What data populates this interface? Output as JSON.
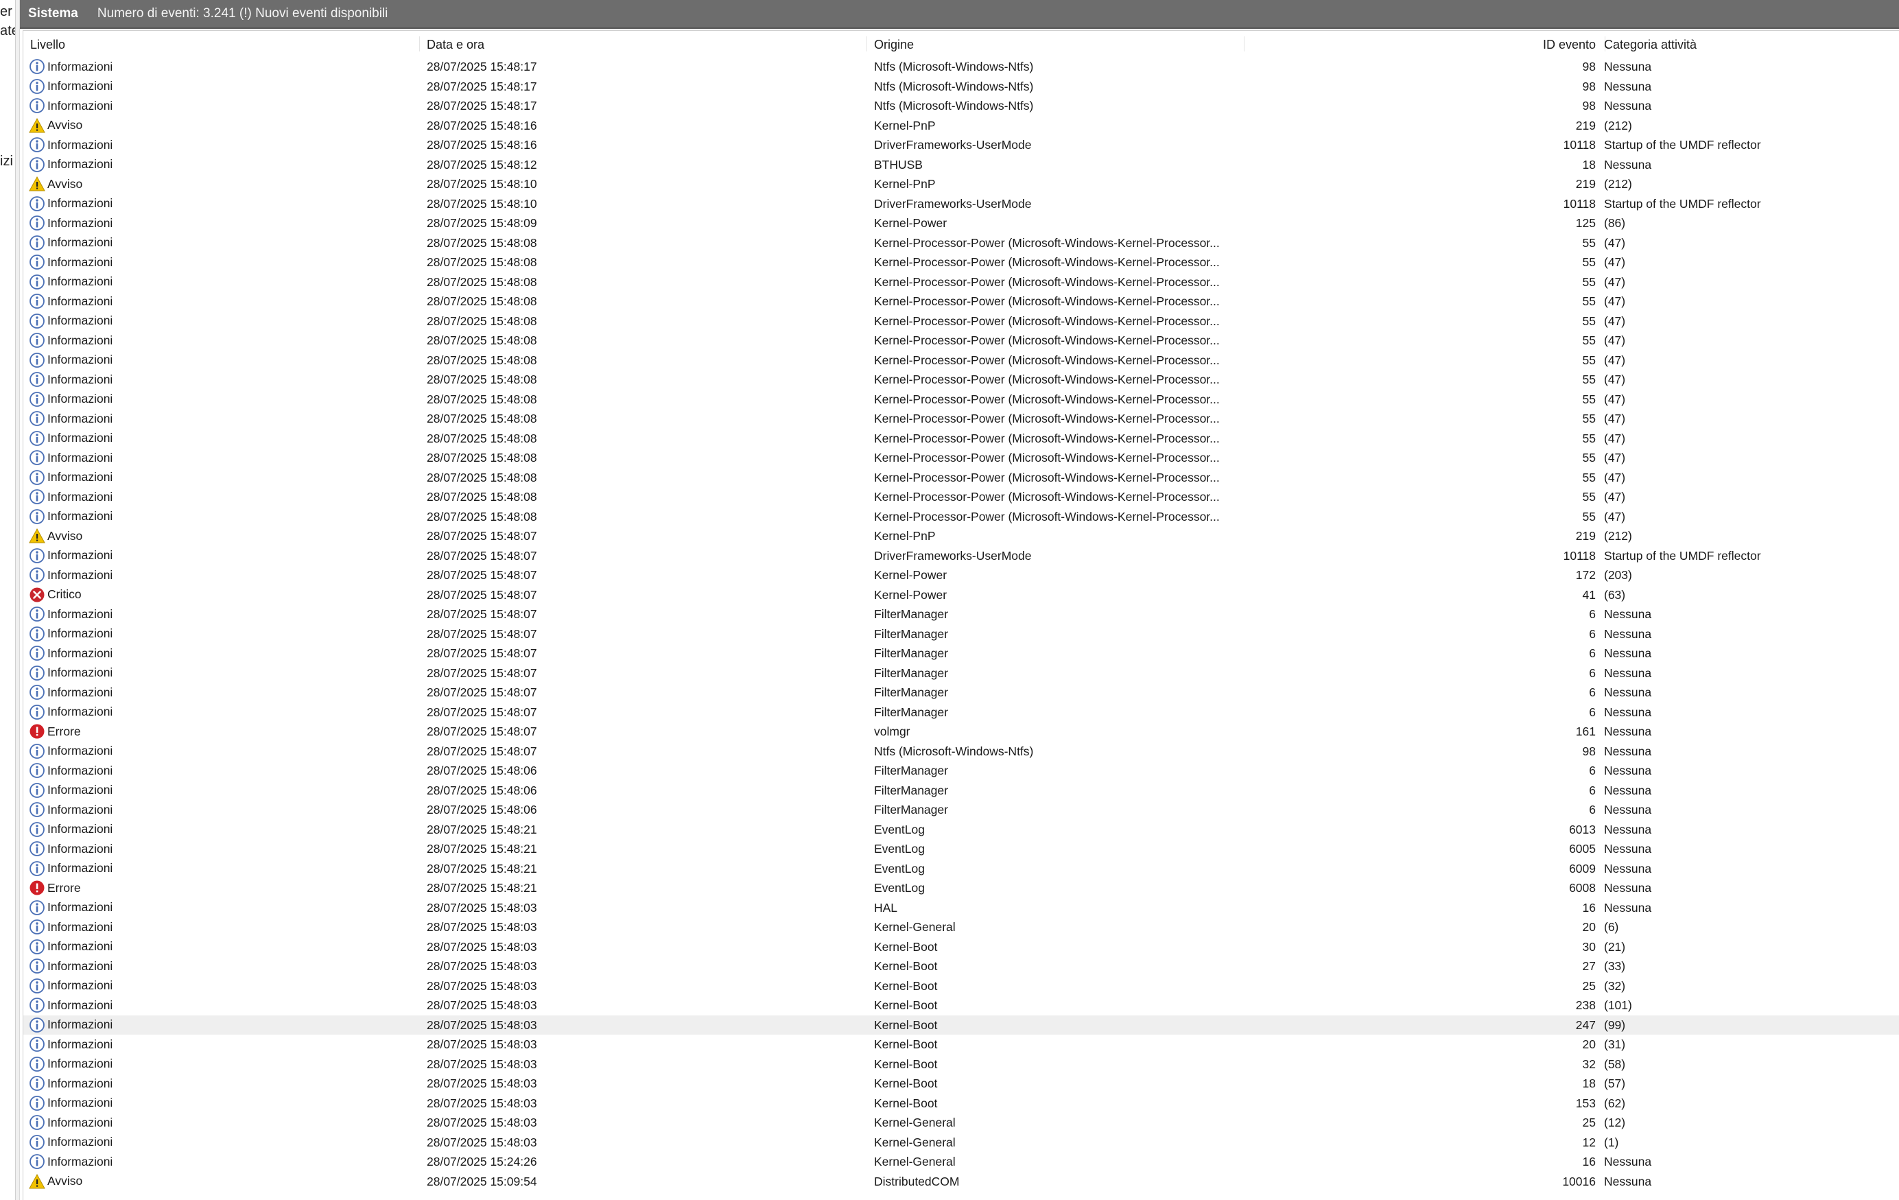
{
  "left_pane_fragments": [
    "er l",
    "ate",
    "izi"
  ],
  "titlebar": {
    "pane_name": "Sistema",
    "info": "Numero di eventi: 3.241 (!) Nuovi eventi disponibili"
  },
  "columns": {
    "level": "Livello",
    "date": "Data e ora",
    "source": "Origine",
    "id": "ID evento",
    "category": "Categoria attività"
  },
  "icon_colors": {
    "info": "#4a6fb5",
    "warning": "#f2c200",
    "error": "#d11f26",
    "critical": "#c8262d"
  },
  "selected_row_index": 49,
  "events": [
    {
      "level": "Informazioni",
      "icon": "info-icon",
      "date": "28/07/2025 15:48:17",
      "source": "Ntfs (Microsoft-Windows-Ntfs)",
      "id": "98",
      "category": "Nessuna"
    },
    {
      "level": "Informazioni",
      "icon": "info-icon",
      "date": "28/07/2025 15:48:17",
      "source": "Ntfs (Microsoft-Windows-Ntfs)",
      "id": "98",
      "category": "Nessuna"
    },
    {
      "level": "Informazioni",
      "icon": "info-icon",
      "date": "28/07/2025 15:48:17",
      "source": "Ntfs (Microsoft-Windows-Ntfs)",
      "id": "98",
      "category": "Nessuna"
    },
    {
      "level": "Avviso",
      "icon": "warning-icon",
      "date": "28/07/2025 15:48:16",
      "source": "Kernel-PnP",
      "id": "219",
      "category": "(212)"
    },
    {
      "level": "Informazioni",
      "icon": "info-icon",
      "date": "28/07/2025 15:48:16",
      "source": "DriverFrameworks-UserMode",
      "id": "10118",
      "category": "Startup of the UMDF reflector"
    },
    {
      "level": "Informazioni",
      "icon": "info-icon",
      "date": "28/07/2025 15:48:12",
      "source": "BTHUSB",
      "id": "18",
      "category": "Nessuna"
    },
    {
      "level": "Avviso",
      "icon": "warning-icon",
      "date": "28/07/2025 15:48:10",
      "source": "Kernel-PnP",
      "id": "219",
      "category": "(212)"
    },
    {
      "level": "Informazioni",
      "icon": "info-icon",
      "date": "28/07/2025 15:48:10",
      "source": "DriverFrameworks-UserMode",
      "id": "10118",
      "category": "Startup of the UMDF reflector"
    },
    {
      "level": "Informazioni",
      "icon": "info-icon",
      "date": "28/07/2025 15:48:09",
      "source": "Kernel-Power",
      "id": "125",
      "category": "(86)"
    },
    {
      "level": "Informazioni",
      "icon": "info-icon",
      "date": "28/07/2025 15:48:08",
      "source": "Kernel-Processor-Power (Microsoft-Windows-Kernel-Processor...",
      "id": "55",
      "category": "(47)"
    },
    {
      "level": "Informazioni",
      "icon": "info-icon",
      "date": "28/07/2025 15:48:08",
      "source": "Kernel-Processor-Power (Microsoft-Windows-Kernel-Processor...",
      "id": "55",
      "category": "(47)"
    },
    {
      "level": "Informazioni",
      "icon": "info-icon",
      "date": "28/07/2025 15:48:08",
      "source": "Kernel-Processor-Power (Microsoft-Windows-Kernel-Processor...",
      "id": "55",
      "category": "(47)"
    },
    {
      "level": "Informazioni",
      "icon": "info-icon",
      "date": "28/07/2025 15:48:08",
      "source": "Kernel-Processor-Power (Microsoft-Windows-Kernel-Processor...",
      "id": "55",
      "category": "(47)"
    },
    {
      "level": "Informazioni",
      "icon": "info-icon",
      "date": "28/07/2025 15:48:08",
      "source": "Kernel-Processor-Power (Microsoft-Windows-Kernel-Processor...",
      "id": "55",
      "category": "(47)"
    },
    {
      "level": "Informazioni",
      "icon": "info-icon",
      "date": "28/07/2025 15:48:08",
      "source": "Kernel-Processor-Power (Microsoft-Windows-Kernel-Processor...",
      "id": "55",
      "category": "(47)"
    },
    {
      "level": "Informazioni",
      "icon": "info-icon",
      "date": "28/07/2025 15:48:08",
      "source": "Kernel-Processor-Power (Microsoft-Windows-Kernel-Processor...",
      "id": "55",
      "category": "(47)"
    },
    {
      "level": "Informazioni",
      "icon": "info-icon",
      "date": "28/07/2025 15:48:08",
      "source": "Kernel-Processor-Power (Microsoft-Windows-Kernel-Processor...",
      "id": "55",
      "category": "(47)"
    },
    {
      "level": "Informazioni",
      "icon": "info-icon",
      "date": "28/07/2025 15:48:08",
      "source": "Kernel-Processor-Power (Microsoft-Windows-Kernel-Processor...",
      "id": "55",
      "category": "(47)"
    },
    {
      "level": "Informazioni",
      "icon": "info-icon",
      "date": "28/07/2025 15:48:08",
      "source": "Kernel-Processor-Power (Microsoft-Windows-Kernel-Processor...",
      "id": "55",
      "category": "(47)"
    },
    {
      "level": "Informazioni",
      "icon": "info-icon",
      "date": "28/07/2025 15:48:08",
      "source": "Kernel-Processor-Power (Microsoft-Windows-Kernel-Processor...",
      "id": "55",
      "category": "(47)"
    },
    {
      "level": "Informazioni",
      "icon": "info-icon",
      "date": "28/07/2025 15:48:08",
      "source": "Kernel-Processor-Power (Microsoft-Windows-Kernel-Processor...",
      "id": "55",
      "category": "(47)"
    },
    {
      "level": "Informazioni",
      "icon": "info-icon",
      "date": "28/07/2025 15:48:08",
      "source": "Kernel-Processor-Power (Microsoft-Windows-Kernel-Processor...",
      "id": "55",
      "category": "(47)"
    },
    {
      "level": "Informazioni",
      "icon": "info-icon",
      "date": "28/07/2025 15:48:08",
      "source": "Kernel-Processor-Power (Microsoft-Windows-Kernel-Processor...",
      "id": "55",
      "category": "(47)"
    },
    {
      "level": "Informazioni",
      "icon": "info-icon",
      "date": "28/07/2025 15:48:08",
      "source": "Kernel-Processor-Power (Microsoft-Windows-Kernel-Processor...",
      "id": "55",
      "category": "(47)"
    },
    {
      "level": "Avviso",
      "icon": "warning-icon",
      "date": "28/07/2025 15:48:07",
      "source": "Kernel-PnP",
      "id": "219",
      "category": "(212)"
    },
    {
      "level": "Informazioni",
      "icon": "info-icon",
      "date": "28/07/2025 15:48:07",
      "source": "DriverFrameworks-UserMode",
      "id": "10118",
      "category": "Startup of the UMDF reflector"
    },
    {
      "level": "Informazioni",
      "icon": "info-icon",
      "date": "28/07/2025 15:48:07",
      "source": "Kernel-Power",
      "id": "172",
      "category": "(203)"
    },
    {
      "level": "Critico",
      "icon": "critical-icon",
      "date": "28/07/2025 15:48:07",
      "source": "Kernel-Power",
      "id": "41",
      "category": "(63)"
    },
    {
      "level": "Informazioni",
      "icon": "info-icon",
      "date": "28/07/2025 15:48:07",
      "source": "FilterManager",
      "id": "6",
      "category": "Nessuna"
    },
    {
      "level": "Informazioni",
      "icon": "info-icon",
      "date": "28/07/2025 15:48:07",
      "source": "FilterManager",
      "id": "6",
      "category": "Nessuna"
    },
    {
      "level": "Informazioni",
      "icon": "info-icon",
      "date": "28/07/2025 15:48:07",
      "source": "FilterManager",
      "id": "6",
      "category": "Nessuna"
    },
    {
      "level": "Informazioni",
      "icon": "info-icon",
      "date": "28/07/2025 15:48:07",
      "source": "FilterManager",
      "id": "6",
      "category": "Nessuna"
    },
    {
      "level": "Informazioni",
      "icon": "info-icon",
      "date": "28/07/2025 15:48:07",
      "source": "FilterManager",
      "id": "6",
      "category": "Nessuna"
    },
    {
      "level": "Informazioni",
      "icon": "info-icon",
      "date": "28/07/2025 15:48:07",
      "source": "FilterManager",
      "id": "6",
      "category": "Nessuna"
    },
    {
      "level": "Errore",
      "icon": "error-icon",
      "date": "28/07/2025 15:48:07",
      "source": "volmgr",
      "id": "161",
      "category": "Nessuna"
    },
    {
      "level": "Informazioni",
      "icon": "info-icon",
      "date": "28/07/2025 15:48:07",
      "source": "Ntfs (Microsoft-Windows-Ntfs)",
      "id": "98",
      "category": "Nessuna"
    },
    {
      "level": "Informazioni",
      "icon": "info-icon",
      "date": "28/07/2025 15:48:06",
      "source": "FilterManager",
      "id": "6",
      "category": "Nessuna"
    },
    {
      "level": "Informazioni",
      "icon": "info-icon",
      "date": "28/07/2025 15:48:06",
      "source": "FilterManager",
      "id": "6",
      "category": "Nessuna"
    },
    {
      "level": "Informazioni",
      "icon": "info-icon",
      "date": "28/07/2025 15:48:06",
      "source": "FilterManager",
      "id": "6",
      "category": "Nessuna"
    },
    {
      "level": "Informazioni",
      "icon": "info-icon",
      "date": "28/07/2025 15:48:21",
      "source": "EventLog",
      "id": "6013",
      "category": "Nessuna"
    },
    {
      "level": "Informazioni",
      "icon": "info-icon",
      "date": "28/07/2025 15:48:21",
      "source": "EventLog",
      "id": "6005",
      "category": "Nessuna"
    },
    {
      "level": "Informazioni",
      "icon": "info-icon",
      "date": "28/07/2025 15:48:21",
      "source": "EventLog",
      "id": "6009",
      "category": "Nessuna"
    },
    {
      "level": "Errore",
      "icon": "error-icon",
      "date": "28/07/2025 15:48:21",
      "source": "EventLog",
      "id": "6008",
      "category": "Nessuna"
    },
    {
      "level": "Informazioni",
      "icon": "info-icon",
      "date": "28/07/2025 15:48:03",
      "source": "HAL",
      "id": "16",
      "category": "Nessuna"
    },
    {
      "level": "Informazioni",
      "icon": "info-icon",
      "date": "28/07/2025 15:48:03",
      "source": "Kernel-General",
      "id": "20",
      "category": "(6)"
    },
    {
      "level": "Informazioni",
      "icon": "info-icon",
      "date": "28/07/2025 15:48:03",
      "source": "Kernel-Boot",
      "id": "30",
      "category": "(21)"
    },
    {
      "level": "Informazioni",
      "icon": "info-icon",
      "date": "28/07/2025 15:48:03",
      "source": "Kernel-Boot",
      "id": "27",
      "category": "(33)"
    },
    {
      "level": "Informazioni",
      "icon": "info-icon",
      "date": "28/07/2025 15:48:03",
      "source": "Kernel-Boot",
      "id": "25",
      "category": "(32)"
    },
    {
      "level": "Informazioni",
      "icon": "info-icon",
      "date": "28/07/2025 15:48:03",
      "source": "Kernel-Boot",
      "id": "238",
      "category": "(101)"
    },
    {
      "level": "Informazioni",
      "icon": "info-icon",
      "date": "28/07/2025 15:48:03",
      "source": "Kernel-Boot",
      "id": "247",
      "category": "(99)"
    },
    {
      "level": "Informazioni",
      "icon": "info-icon",
      "date": "28/07/2025 15:48:03",
      "source": "Kernel-Boot",
      "id": "20",
      "category": "(31)"
    },
    {
      "level": "Informazioni",
      "icon": "info-icon",
      "date": "28/07/2025 15:48:03",
      "source": "Kernel-Boot",
      "id": "32",
      "category": "(58)"
    },
    {
      "level": "Informazioni",
      "icon": "info-icon",
      "date": "28/07/2025 15:48:03",
      "source": "Kernel-Boot",
      "id": "18",
      "category": "(57)"
    },
    {
      "level": "Informazioni",
      "icon": "info-icon",
      "date": "28/07/2025 15:48:03",
      "source": "Kernel-Boot",
      "id": "153",
      "category": "(62)"
    },
    {
      "level": "Informazioni",
      "icon": "info-icon",
      "date": "28/07/2025 15:48:03",
      "source": "Kernel-General",
      "id": "25",
      "category": "(12)"
    },
    {
      "level": "Informazioni",
      "icon": "info-icon",
      "date": "28/07/2025 15:48:03",
      "source": "Kernel-General",
      "id": "12",
      "category": "(1)"
    },
    {
      "level": "Informazioni",
      "icon": "info-icon",
      "date": "28/07/2025 15:24:26",
      "source": "Kernel-General",
      "id": "16",
      "category": "Nessuna"
    },
    {
      "level": "Avviso",
      "icon": "warning-icon",
      "date": "28/07/2025 15:09:54",
      "source": "DistributedCOM",
      "id": "10016",
      "category": "Nessuna"
    }
  ]
}
